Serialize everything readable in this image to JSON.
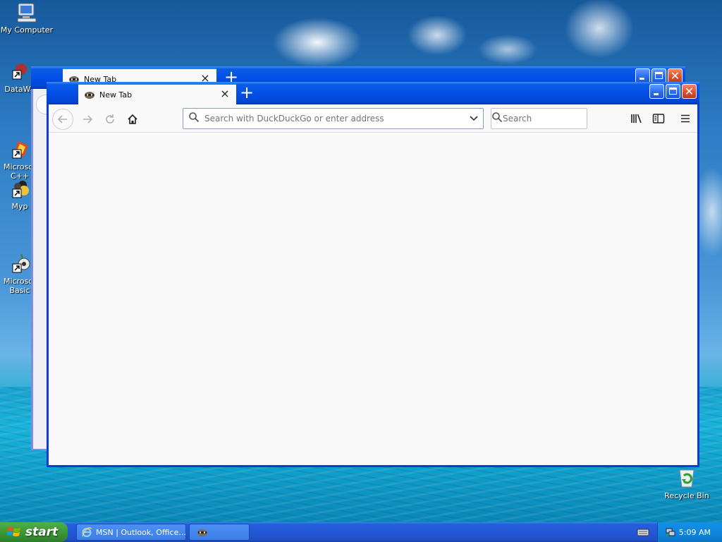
{
  "desktop": {
    "icons": [
      {
        "label": "My Computer"
      },
      {
        "label": "DataWa"
      },
      {
        "label": "Microsof\nC++"
      },
      {
        "label": "Myp"
      },
      {
        "label": "Microsof\nBasic"
      },
      {
        "label": "Recycle Bin"
      }
    ]
  },
  "back_window": {
    "tab_title": "New Tab"
  },
  "front_window": {
    "tab_title": "New Tab",
    "urlbar_placeholder": "Search with DuckDuckGo or enter address",
    "searchbar_placeholder": "Search"
  },
  "taskbar": {
    "start_label": "start",
    "items": [
      {
        "label": "MSN | Outlook, Office..."
      },
      {
        "label": ""
      }
    ],
    "clock": "5:09 AM"
  },
  "icons": {
    "back": "back-arrow-icon",
    "forward": "forward-arrow-icon",
    "reload": "reload-icon",
    "home": "home-icon",
    "library": "library-icon",
    "sidebar": "sidebar-icon",
    "menu": "hamburger-menu-icon"
  }
}
